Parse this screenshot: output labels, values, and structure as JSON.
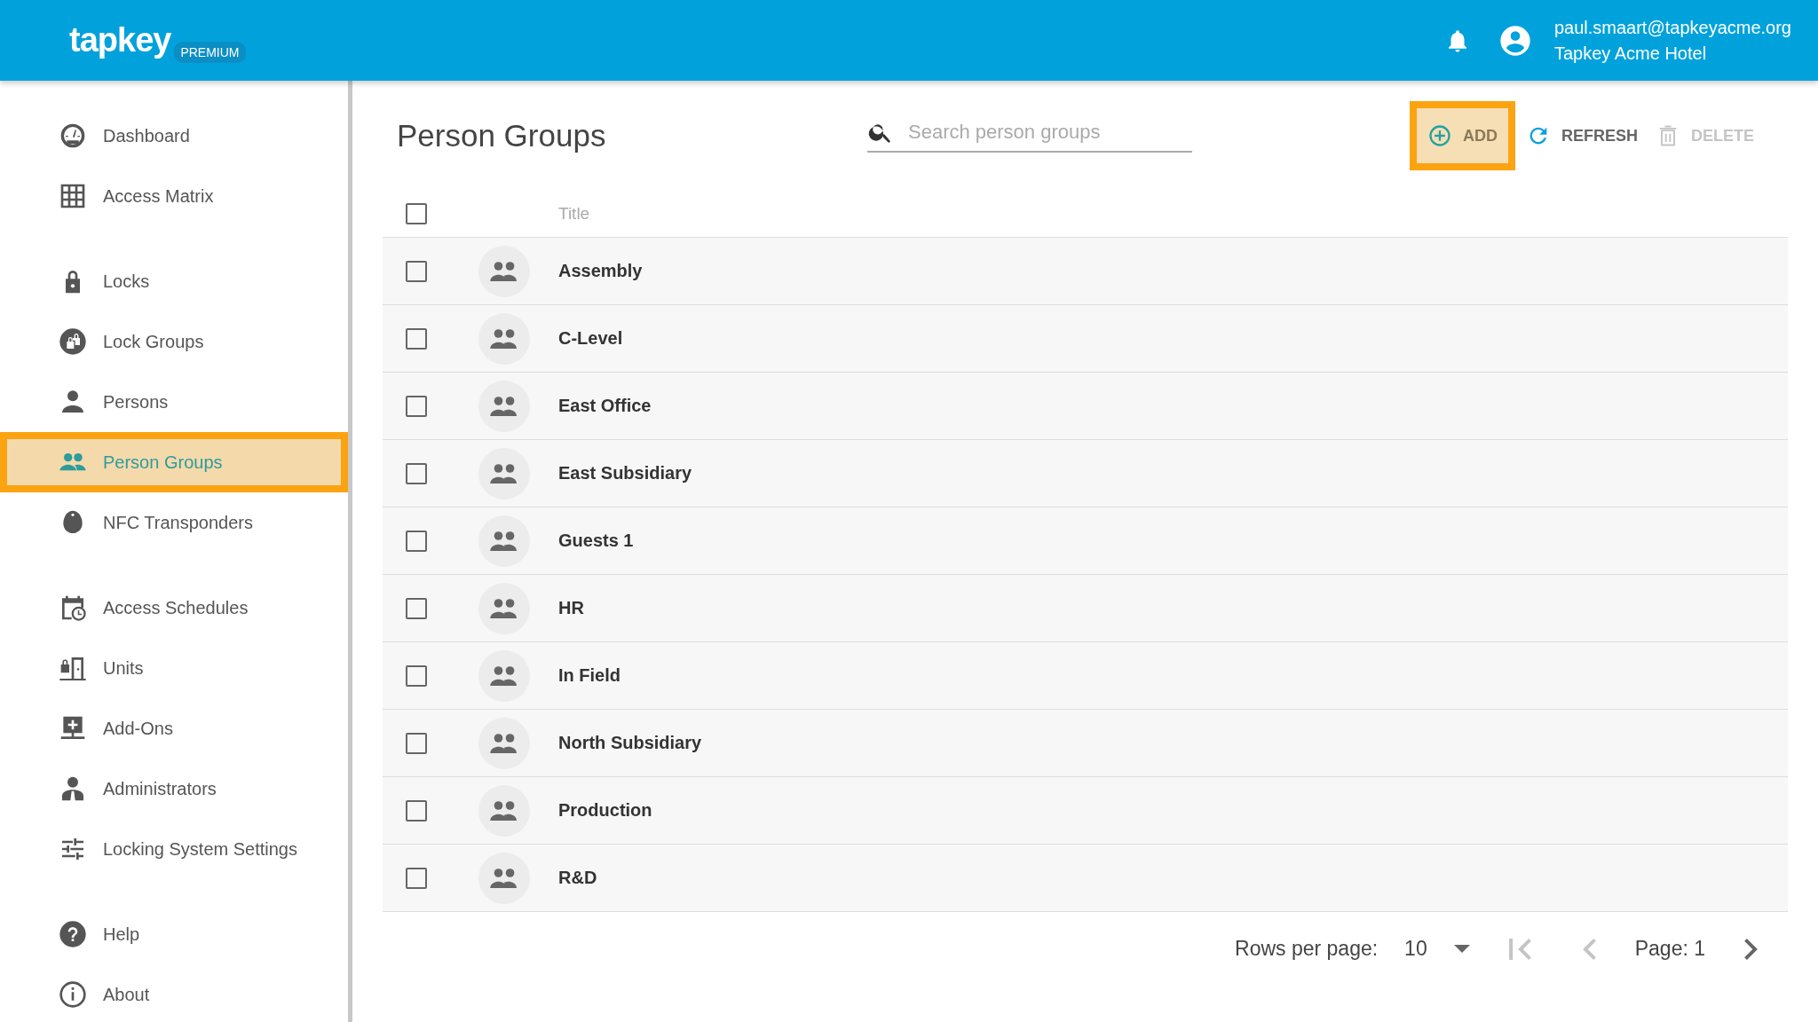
{
  "header": {
    "logo": "tapkey",
    "badge": "PREMIUM",
    "user_email": "paul.smaart@tapkeyacme.org",
    "organization": "Tapkey Acme Hotel"
  },
  "sidebar": {
    "sections": [
      {
        "items": [
          {
            "label": "Dashboard",
            "selected": false
          },
          {
            "label": "Access Matrix",
            "selected": false
          }
        ]
      },
      {
        "items": [
          {
            "label": "Locks",
            "selected": false
          },
          {
            "label": "Lock Groups",
            "selected": false
          },
          {
            "label": "Persons",
            "selected": false
          },
          {
            "label": "Person Groups",
            "selected": true
          },
          {
            "label": "NFC Transponders",
            "selected": false
          }
        ]
      },
      {
        "items": [
          {
            "label": "Access Schedules",
            "selected": false
          },
          {
            "label": "Units",
            "selected": false
          },
          {
            "label": "Add-Ons",
            "selected": false
          },
          {
            "label": "Administrators",
            "selected": false
          },
          {
            "label": "Locking System Settings",
            "selected": false
          }
        ]
      },
      {
        "items": [
          {
            "label": "Help",
            "selected": false
          },
          {
            "label": "About",
            "selected": false
          }
        ]
      }
    ]
  },
  "page": {
    "title": "Person Groups",
    "search": {
      "placeholder": "Search person groups"
    },
    "actions": [
      {
        "kind": "add",
        "label": "ADD",
        "highlighted": true,
        "disabled": false
      },
      {
        "kind": "refresh",
        "label": "REFRESH",
        "highlighted": false,
        "disabled": false
      },
      {
        "kind": "delete",
        "label": "DELETE",
        "highlighted": false,
        "disabled": true
      }
    ]
  },
  "table": {
    "header_checked": false,
    "columns": [
      "Title"
    ],
    "rows": [
      {
        "title": "Assembly",
        "checked": false
      },
      {
        "title": "C-Level",
        "checked": false
      },
      {
        "title": "East Office",
        "checked": false
      },
      {
        "title": "East Subsidiary",
        "checked": false
      },
      {
        "title": "Guests 1",
        "checked": false
      },
      {
        "title": "HR",
        "checked": false
      },
      {
        "title": "In Field",
        "checked": false
      },
      {
        "title": "North Subsidiary",
        "checked": false
      },
      {
        "title": "Production",
        "checked": false
      },
      {
        "title": "R&D",
        "checked": false
      }
    ]
  },
  "pagination": {
    "rows_label": "Rows per page:",
    "rows_value": "10",
    "page_label": "Page: 1",
    "first_disabled": true,
    "prev_disabled": true,
    "next_disabled": false
  }
}
